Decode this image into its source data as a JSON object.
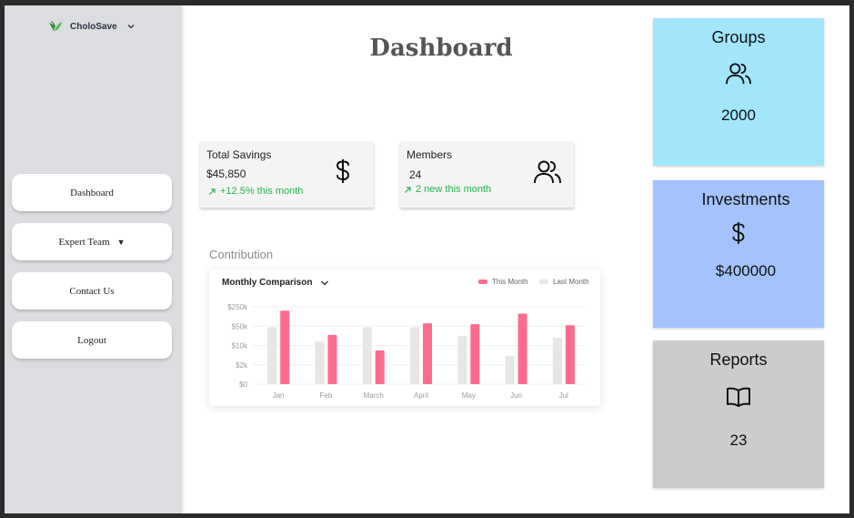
{
  "brand": {
    "name": "CholoSave"
  },
  "sidebar": {
    "items": [
      {
        "label": "Dashboard"
      },
      {
        "label": "Expert Team",
        "has_dropdown": true
      },
      {
        "label": "Contact Us"
      },
      {
        "label": "Logout"
      }
    ]
  },
  "page": {
    "title": "Dashboard"
  },
  "stats": {
    "total_savings": {
      "label": "Total Savings",
      "value": "$45,850",
      "trend": "+12.5% this month"
    },
    "members": {
      "label": "Members",
      "value": "24",
      "trend": "2 new this month"
    }
  },
  "contribution": {
    "label": "Contribution",
    "chart_title": "Monthly Comparison",
    "legend": {
      "this_month": "This Month",
      "last_month": "Last Month"
    }
  },
  "chart_data": {
    "type": "bar",
    "title": "Monthly Comparison",
    "categories": [
      "Jan",
      "Feb",
      "March",
      "April",
      "May",
      "Jun",
      "Jul"
    ],
    "y_ticks": [
      "$0",
      "$2k",
      "$10k",
      "$50k",
      "$250k"
    ],
    "y_levels": [
      0,
      1,
      2,
      3,
      4
    ],
    "series": [
      {
        "name": "Last Month",
        "color": "#e6e6e6",
        "values": [
          2.95,
          2.2,
          2.95,
          2.95,
          2.5,
          1.45,
          2.4
        ]
      },
      {
        "name": "This Month",
        "color": "#ff6b8f",
        "values": [
          3.8,
          2.55,
          1.75,
          3.15,
          3.1,
          3.65,
          3.05
        ]
      }
    ],
    "ylim": [
      0,
      4
    ],
    "grid": true,
    "legend_position": "top-right"
  },
  "tiles": {
    "groups": {
      "title": "Groups",
      "value": "2000",
      "icon": "users-icon",
      "color": "#a3e6fc"
    },
    "investments": {
      "title": "Investments",
      "value": "$400000",
      "icon": "dollar-icon",
      "color": "#a4c3fd"
    },
    "reports": {
      "title": "Reports",
      "value": "23",
      "icon": "book-icon",
      "color": "#cccccc"
    }
  },
  "colors": {
    "accent_pink": "#ff6b8f",
    "trend_green": "#22b44a",
    "sidebar_bg": "#dcdde0"
  }
}
